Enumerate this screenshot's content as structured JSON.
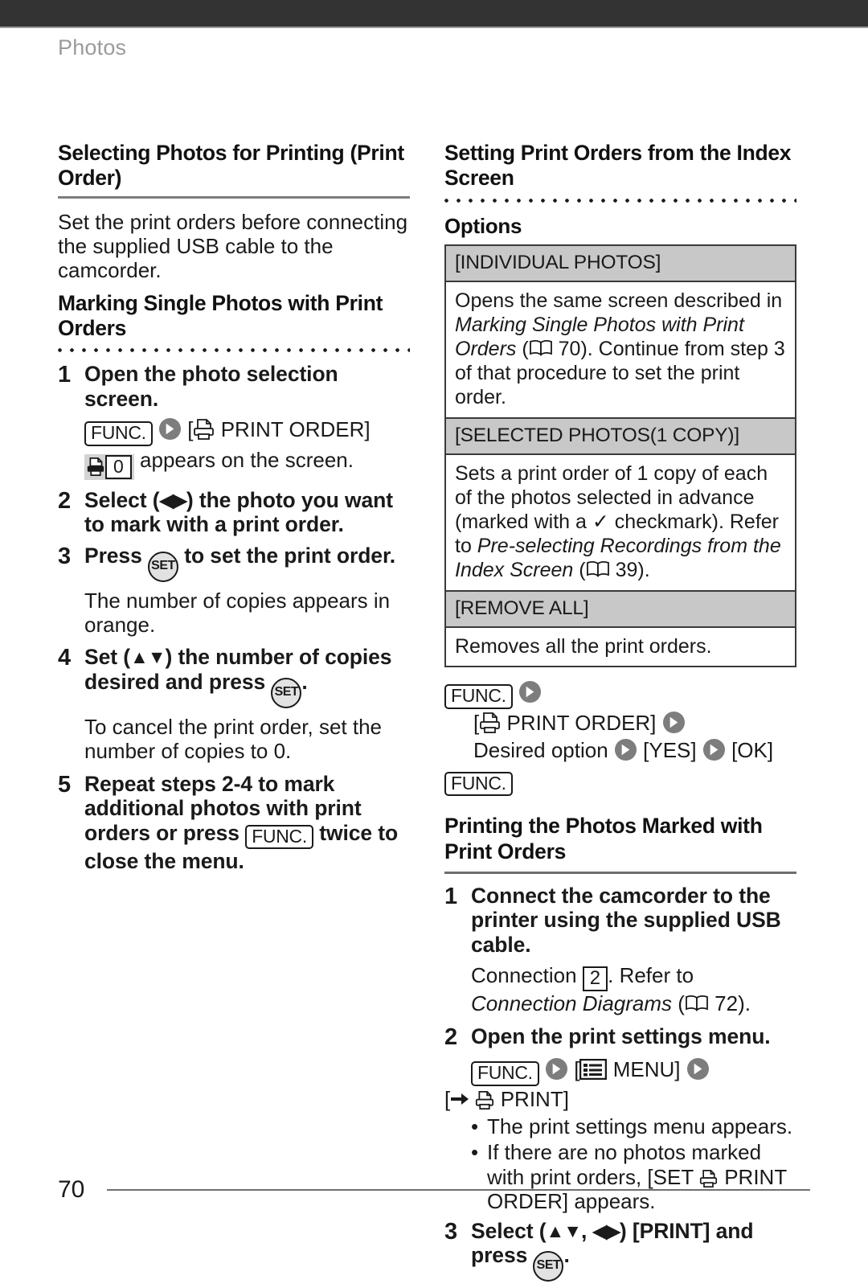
{
  "running_head": "Photos",
  "page_number": "70",
  "left_column": {
    "section_heading": "Selecting Photos for Printing (Print Order)",
    "intro": "Set the print orders before connecting the supplied USB cable to the camcorder.",
    "sub_heading": "Marking Single Photos with Print Orders",
    "steps": [
      {
        "num": "1",
        "title": "Open the photo selection screen.",
        "menu_prefix": "FUNC.",
        "menu_item": "[",
        "menu_label": "PRINT ORDER]",
        "appears_text": "appears on the screen.",
        "count_value": "0"
      },
      {
        "num": "2",
        "title_a": "Select (",
        "title_arrows": "◀▶",
        "title_b": ") the photo you want to mark with a print order."
      },
      {
        "num": "3",
        "title_a": "Press",
        "set_label": "SET",
        "title_b": "to set the print order.",
        "note": "The number of copies appears in orange."
      },
      {
        "num": "4",
        "title_a": "Set (",
        "title_arrows": "▲▼",
        "title_b": ") the number of copies desired and press",
        "set_label": "SET",
        "title_c": ".",
        "note": "To cancel the print order, set the number of copies to 0."
      },
      {
        "num": "5",
        "title_a": "Repeat steps 2-4 to mark additional photos with print orders or press",
        "func_label": "FUNC.",
        "title_b": "twice to close the menu."
      }
    ]
  },
  "right_column": {
    "section_heading": "Setting Print Orders from the Index Screen",
    "options_label": "Options",
    "options": [
      {
        "name": "[INDIVIDUAL PHOTOS]",
        "desc_a": "Opens the same screen described in ",
        "desc_italic": "Marking Single Photos with Print Orders",
        "desc_paren_open": " (",
        "page_ref": "70",
        "desc_paren_close": ").",
        "desc_b": " Continue from step 3 of that procedure to set the print order."
      },
      {
        "name": "[SELECTED PHOTOS(1 COPY)]",
        "desc_a": "Sets a print order of 1 copy of each of the photos selected in advance (marked with a ",
        "checkmark": "✓",
        "desc_b": " checkmark). Refer to ",
        "desc_italic": "Pre-selecting Recordings from the Index Screen",
        "desc_paren_open": " (",
        "page_ref": "39",
        "desc_paren_close": ")."
      },
      {
        "name": "[REMOVE ALL]",
        "desc_a": "Removes all the print orders."
      }
    ],
    "menu_path": {
      "func_1": "FUNC.",
      "line2_open": "[",
      "line2_label": "PRINT ORDER]",
      "line3_option": "Desired option",
      "line3_yes": "[YES]",
      "line3_ok": "[OK]",
      "func_2": "FUNC."
    },
    "sub_heading": "Printing the Photos Marked with Print Orders",
    "steps": [
      {
        "num": "1",
        "title": "Connect the camcorder to the printer using the supplied USB cable.",
        "note_a": "Connection ",
        "note_box": "2",
        "note_b": ". Refer to ",
        "note_italic": "Connection Diagrams",
        "note_paren_open": " (",
        "page_ref": "72",
        "note_paren_close": ")."
      },
      {
        "num": "2",
        "title": "Open the print settings menu.",
        "func_label": "FUNC.",
        "menu_open": "[",
        "menu_label": "MENU]",
        "print_line_open": "[",
        "print_line_label": "PRINT]",
        "bullets": [
          "The print settings menu appears.",
          "If there are no photos marked with print orders, [SET ⎙ PRINT ORDER] appears."
        ],
        "bullet2_a": "If there are no photos marked with print orders, [SET",
        "bullet2_b": "PRINT ORDER] appears."
      },
      {
        "num": "3",
        "title_a": "Select (",
        "title_arrows_1": "▲▼",
        "title_comma": ", ",
        "title_arrows_2": "◀▶",
        "title_b": ") [PRINT] and press",
        "set_label": "SET",
        "title_c": "."
      }
    ]
  },
  "colors": {
    "top_bar": "#333333",
    "running_head": "#9b9b9b",
    "table_header_bg": "#c8c8c8",
    "rule": "#7d7d7d",
    "accent_gray_button": "#6e6e6e"
  },
  "icons": {
    "printer": "printer-icon",
    "book": "book-page-reference-icon",
    "menu": "menu-list-icon",
    "arrow_circle": "arrow-right-circle-icon",
    "right_arrow": "right-arrow-icon"
  }
}
